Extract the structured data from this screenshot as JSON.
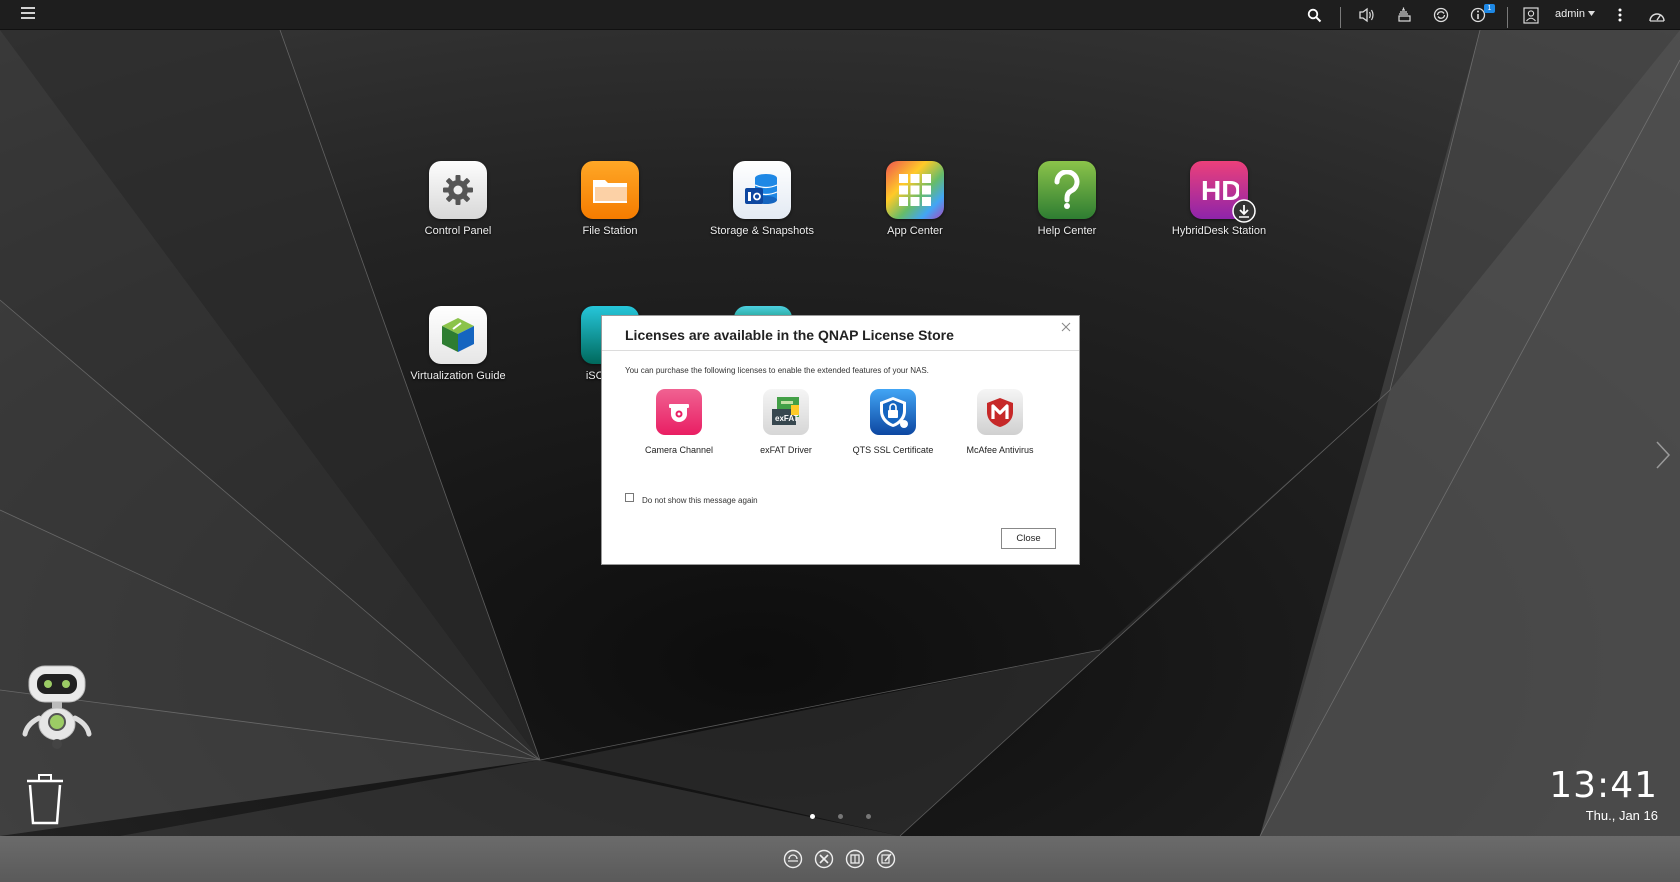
{
  "topbar": {
    "username": "admin",
    "notification_count": "1",
    "icons": [
      "menu-icon",
      "search-icon",
      "volume-icon",
      "tasks-icon",
      "sync-icon",
      "info-icon",
      "user-icon",
      "more-icon",
      "dashboard-icon"
    ]
  },
  "desktop": {
    "apps": [
      {
        "label": "Control Panel",
        "icon": "gear-icon"
      },
      {
        "label": "File Station",
        "icon": "folder-icon"
      },
      {
        "label": "Storage & Snapshots",
        "icon": "storage-icon"
      },
      {
        "label": "App Center",
        "icon": "grid-icon"
      },
      {
        "label": "Help Center",
        "icon": "question-icon"
      },
      {
        "label": "HybridDesk Station",
        "icon": "hd-icon"
      },
      {
        "label": "Virtualization Guide",
        "icon": "cube-icon"
      },
      {
        "label": "iSCSI & F",
        "icon": "iscsi-icon"
      }
    ],
    "page_indicator": {
      "pages": 3,
      "active": 1
    }
  },
  "modal": {
    "title": "Licenses are available in the QNAP License Store",
    "description": "You can purchase the following licenses to enable the extended features of your NAS.",
    "licenses": [
      {
        "label": "Camera Channel",
        "icon": "camera-icon",
        "color": "#e91e63"
      },
      {
        "label": "exFAT Driver",
        "icon": "exfat-icon",
        "color": "#43a047"
      },
      {
        "label": "QTS SSL Certificate",
        "icon": "ssl-shield-icon",
        "color": "#1565c0"
      },
      {
        "label": "McAfee Antivirus",
        "icon": "mcafee-icon",
        "color": "#c62828"
      }
    ],
    "checkbox_label": "Do not show this message again",
    "checkbox_checked": false,
    "close_label": "Close"
  },
  "clock": {
    "time": "13:41",
    "date": "Thu., Jan 16"
  },
  "dock": {
    "icons": [
      "dock-remote-icon",
      "dock-tools-icon",
      "dock-book-icon",
      "dock-edit-icon"
    ]
  }
}
